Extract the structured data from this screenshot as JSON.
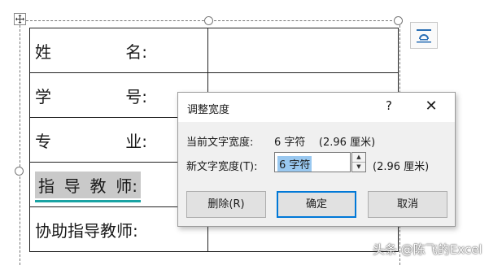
{
  "form": {
    "rows": [
      {
        "label_chars": [
          "姓",
          "名:"
        ]
      },
      {
        "label_chars": [
          "学",
          "号:"
        ]
      },
      {
        "label_chars": [
          "专",
          "业:"
        ]
      },
      {
        "label_chars": [
          "指",
          "导",
          "教",
          "师:"
        ]
      },
      {
        "label": "协助指导教师:"
      }
    ]
  },
  "dialog": {
    "title": "调整宽度",
    "help": "?",
    "close": "✕",
    "current_label": "当前文字宽度:",
    "current_value": "6 字符    (2.96 厘米)",
    "new_label": "新文字宽度(T):",
    "new_value": "6 字符",
    "new_cm": "(2.96 厘米)",
    "buttons": {
      "delete": "删除(R)",
      "ok": "确定",
      "cancel": "取消"
    }
  },
  "watermark": "头条 @陈飞的Excel",
  "icons": {
    "move": "move-icon",
    "layout_options": "layout-options-icon",
    "spin_up": "spin-up-icon",
    "spin_down": "spin-down-icon"
  }
}
